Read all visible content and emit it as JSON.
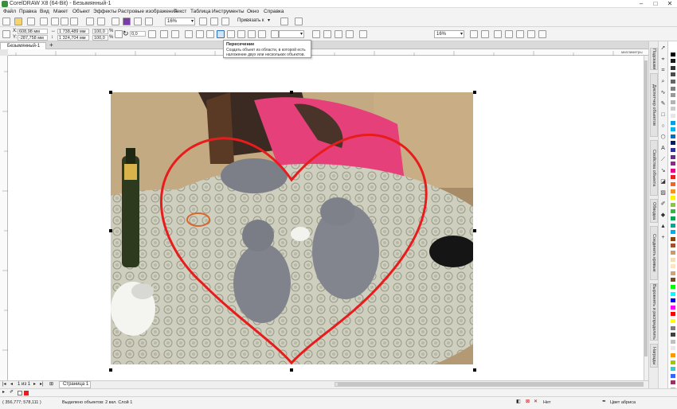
{
  "window": {
    "title": "CorelDRAW X8 (64-Bit) - Безымянный-1",
    "controls": [
      "–",
      "□",
      "✕"
    ]
  },
  "menu": [
    "Файл",
    "Правка",
    "Вид",
    "Макет",
    "Объект",
    "Эффекты",
    "Растровые изображения",
    "Текст",
    "Таблица",
    "Инструменты",
    "Окно",
    "Справка"
  ],
  "toolbar1": {
    "zoom_value": "16%",
    "snap_label": "Привязать к"
  },
  "toolbar2": {
    "x_label": "X:",
    "x_value": "608,98 мм",
    "y_label": "Y:",
    "y_value": "-287,758 мм",
    "width_value": "1 738,489 мм",
    "height_value": "1 324,704 мм",
    "scale_x": "100,0",
    "scale_y": "100,0",
    "percent": "%",
    "rotation_value": "0,0",
    "zoom_right": "16%"
  },
  "tooltip": {
    "title": "Пересечение",
    "body": "Создать объект из области, в которой есть наложение двух или нескольких объектов."
  },
  "document": {
    "tab_label": "Безымянный-1",
    "ruler_unit": "миллиметры",
    "page_label": "Страница 1",
    "page_counter": "1 из 1"
  },
  "dock_tabs": [
    "Подсказки",
    "Диспетчер объектов",
    "Свойства объекта",
    "Обводка",
    "Соединить кривые",
    "Выровнять и распределить",
    "Награды"
  ],
  "palette_colors": [
    "#ffffff",
    "#000000",
    "#1a1a1a",
    "#333333",
    "#4d4d4d",
    "#666666",
    "#808080",
    "#999999",
    "#b3b3b3",
    "#cccccc",
    "#e6e6e6",
    "#00a0e3",
    "#00b0f0",
    "#0070c0",
    "#002060",
    "#2e3192",
    "#662d91",
    "#92278f",
    "#ec008c",
    "#ed1c24",
    "#f26522",
    "#f7941d",
    "#fff200",
    "#8dc63f",
    "#39b54a",
    "#00a651",
    "#00a99d",
    "#00aeef",
    "#8b4513",
    "#a0522d",
    "#c69c6d",
    "#f5deb3",
    "#ffe4c4",
    "#d4a373",
    "#754c24",
    "#00ff00",
    "#00ffff",
    "#0000ff",
    "#ff00ff",
    "#ff0000",
    "#ffff00",
    "#7f7f7f",
    "#404040",
    "#c0c0c0",
    "#e8e8e8",
    "#ff9900",
    "#99cc00",
    "#33cccc",
    "#3366ff",
    "#993366",
    "#cc99ff"
  ],
  "status": {
    "coords": "( 356,777; 578,111 )",
    "selection_info": "Выделено объектов: 2 вкл. Слой 1",
    "fill_label": "Нет",
    "outline_label": "Цвет абриса"
  }
}
